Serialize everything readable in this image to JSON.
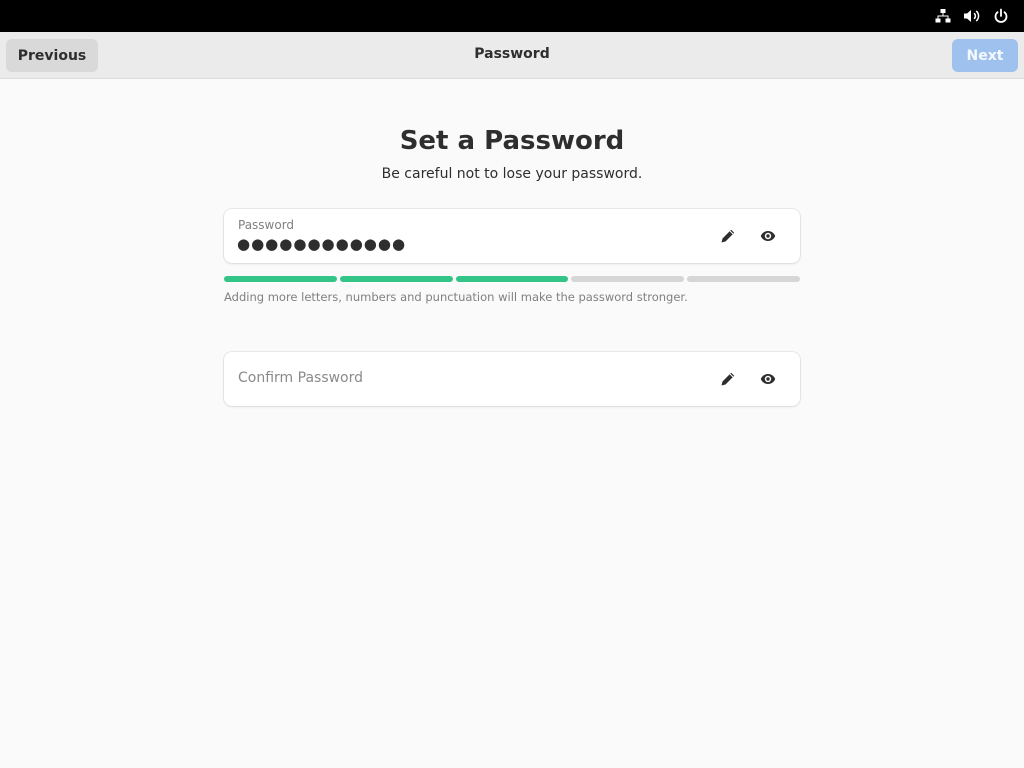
{
  "system_tray": {
    "icons": [
      "network-icon",
      "volume-icon",
      "power-icon"
    ]
  },
  "headerbar": {
    "previous_label": "Previous",
    "title": "Password",
    "next_label": "Next",
    "next_enabled": false
  },
  "page": {
    "heading": "Set a Password",
    "subheading": "Be careful not to lose your password."
  },
  "password_field": {
    "label": "Password",
    "value": "●●●●●●●●●●●●",
    "edit_icon": "pencil-icon",
    "reveal_icon": "eye-icon"
  },
  "strength": {
    "segments_total": 5,
    "segments_filled": 3,
    "color_filled": "#33c488",
    "hint": "Adding more letters, numbers and punctuation will make the password stronger."
  },
  "confirm_field": {
    "placeholder": "Confirm Password",
    "edit_icon": "pencil-icon",
    "reveal_icon": "eye-icon"
  },
  "colors": {
    "accent_disabled": "#9ec1ee",
    "background": "#fafafa",
    "headerbar": "#ebebeb"
  }
}
